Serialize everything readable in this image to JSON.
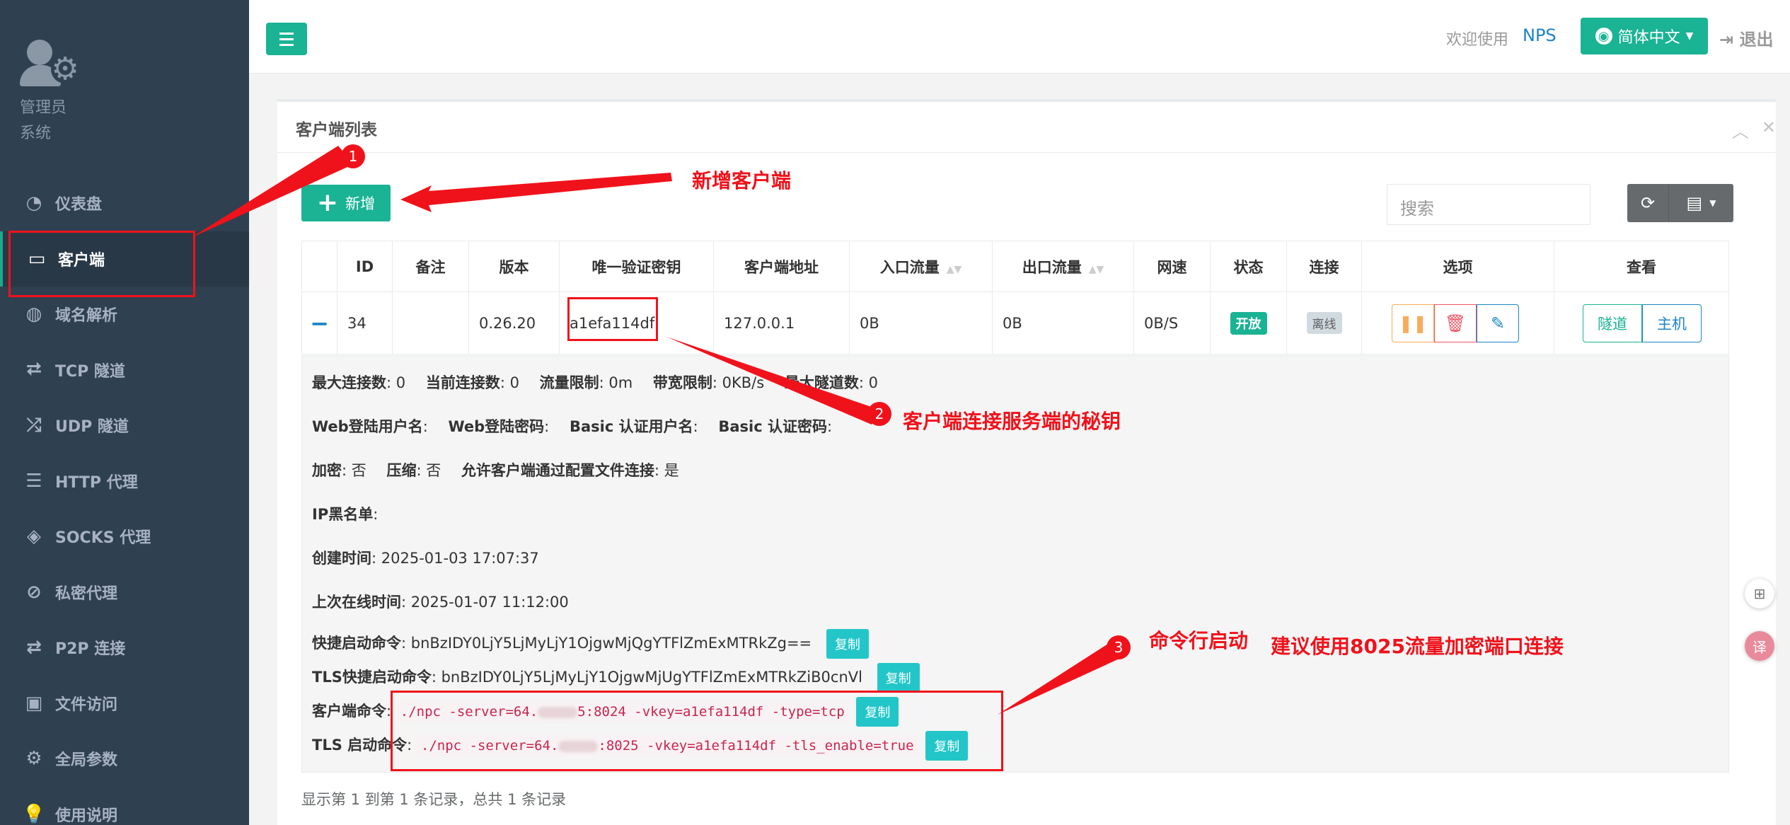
{
  "profile": {
    "name": "管理员",
    "role": "系统"
  },
  "sidebar": {
    "items": [
      {
        "label": "仪表盘",
        "icon": "◔"
      },
      {
        "label": "客户端",
        "icon": "▭"
      },
      {
        "label": "域名解析",
        "icon": "◍"
      },
      {
        "label": "TCP 隧道",
        "icon": "⮂"
      },
      {
        "label": "UDP 隧道",
        "icon": "⤮"
      },
      {
        "label": "HTTP 代理",
        "icon": "☰"
      },
      {
        "label": "SOCKS 代理",
        "icon": "◈"
      },
      {
        "label": "私密代理",
        "icon": "⊘"
      },
      {
        "label": "P2P 连接",
        "icon": "⇄"
      },
      {
        "label": "文件访问",
        "icon": "▣"
      },
      {
        "label": "全局参数",
        "icon": "⚙"
      },
      {
        "label": "使用说明",
        "icon": "💡"
      }
    ]
  },
  "topbar": {
    "welcome": "欢迎使用",
    "app_name": "NPS",
    "language": "简体中文",
    "logout": "退出"
  },
  "panel": {
    "title": "客户端列表",
    "add_label": "新增",
    "search_placeholder": "搜索"
  },
  "table": {
    "headers": {
      "id": "ID",
      "remark": "备注",
      "version": "版本",
      "vkey": "唯一验证密钥",
      "addr": "客户端地址",
      "in_flow": "入口流量",
      "out_flow": "出口流量",
      "speed": "网速",
      "status": "状态",
      "conn": "连接",
      "options": "选项",
      "view": "查看"
    },
    "row": {
      "id": "34",
      "remark": "",
      "version": "0.26.20",
      "vkey": "a1efa114df",
      "addr": "127.0.0.1",
      "in_flow": "0B",
      "out_flow": "0B",
      "speed": "0B/S",
      "status": "开放",
      "conn": "离线",
      "tunnel_btn": "隧道",
      "host_btn": "主机"
    }
  },
  "detail": {
    "max_conn_label": "最大连接数",
    "max_conn": ": 0",
    "cur_conn_label": "当前连接数",
    "cur_conn": ": 0",
    "flow_limit_label": "流量限制",
    "flow_limit": ": 0m",
    "bw_limit_label": "带宽限制",
    "bw_limit": ": 0KB/s",
    "max_tunnel_label": "最大隧道数",
    "max_tunnel": ": 0",
    "web_user_label": "Web登陆用户名",
    "web_pass_label": "Web登陆密码",
    "basic_user_label": "Basic 认证用户名",
    "basic_pass_label": "Basic 认证密码",
    "colon": ":",
    "crypt_label": "加密",
    "crypt": ": 否",
    "compress_label": "压缩",
    "compress": ": 否",
    "config_conn_label": "允许客户端通过配置文件连接",
    "config_conn": ": 是",
    "blacklist_label": "IP黑名单",
    "created_label": "创建时间",
    "created": ": 2025-01-03 17:07:37",
    "last_online_label": "上次在线时间",
    "last_online": ": 2025-01-07 11:12:00",
    "quick_cmd_label": "快捷启动命令",
    "quick_cmd": ": bnBzIDY0LjY5LjMyLjY1OjgwMjQgYTFlZmExMTRkZg==",
    "tls_quick_label": "TLS快捷启动命令",
    "tls_quick": ": bnBzIDY0LjY5LjMyLjY1OjgwMjUgYTFlZmExMTRkZiB0cnVl",
    "client_cmd_label": "客户端命令",
    "client_cmd_a": "./npc -server=64.",
    "client_cmd_b": "5:8024 -vkey=a1efa114df -type=tcp",
    "tls_cmd_label": "TLS 启动命令",
    "tls_cmd_a": "./npc -server=64.",
    "tls_cmd_b": ":8025 -vkey=a1efa114df -tls_enable=true",
    "copy": "复制"
  },
  "footer": "显示第 1 到第 1 条记录，总共 1 条记录",
  "annotations": {
    "a1_num": "1",
    "a1_text": "新增客户端",
    "a2_num": "2",
    "a2_text": "客户端连接服务端的秘钥",
    "a3_num": "3",
    "a3_text": "命令行启动",
    "a3_tip": "建议使用8025流量加密端口连接"
  },
  "colors": {
    "primary": "#1ab394",
    "sidebar": "#2f4050",
    "annotation": "#f0121b"
  }
}
